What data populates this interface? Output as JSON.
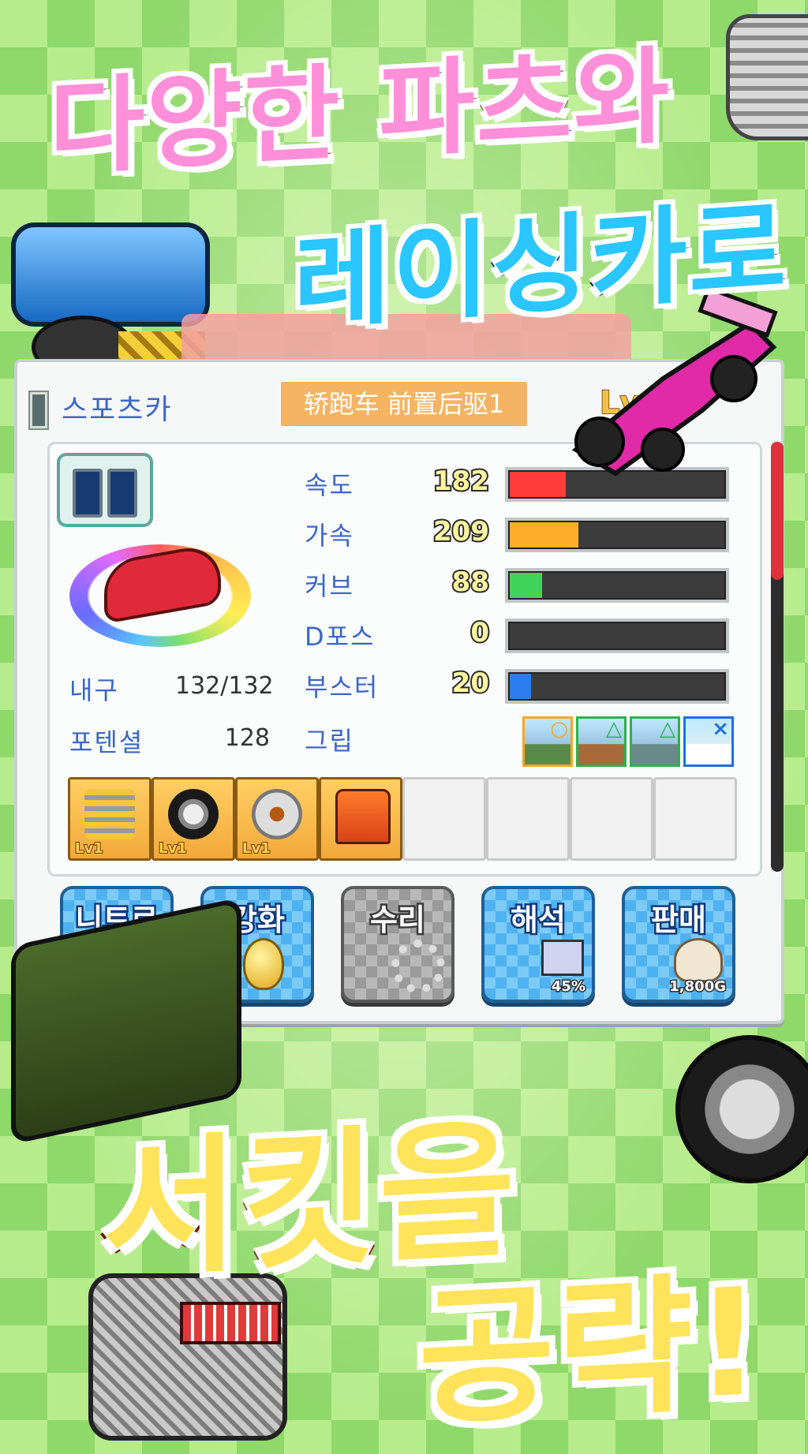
{
  "headlines": {
    "line1": "다양한 파츠와",
    "line2": "레이싱카로",
    "line3": "서킷을",
    "line4": "공략!"
  },
  "panel": {
    "car_name": "스포츠카",
    "type_badge": "轿跑车 前置后驱1",
    "level_badge": "Lv"
  },
  "stats": [
    {
      "label": "속도",
      "value": 182,
      "fill": 0.26,
      "color": "#ff3b3b"
    },
    {
      "label": "가속",
      "value": 209,
      "fill": 0.32,
      "color": "#ffae2b"
    },
    {
      "label": "커브",
      "value": 88,
      "fill": 0.15,
      "color": "#3fd35a"
    },
    {
      "label": "D포스",
      "value": 0,
      "fill": 0.0,
      "color": "#888888"
    },
    {
      "label": "부스터",
      "value": 20,
      "fill": 0.1,
      "color": "#2d7cf0"
    }
  ],
  "left_stats": {
    "durability_label": "내구",
    "durability_value": "132/132",
    "potential_label": "포텐셜",
    "potential_value": "128"
  },
  "grip": {
    "label": "그립",
    "ratings": [
      {
        "symbol": "○",
        "color": "#f5a623",
        "terrain": "road"
      },
      {
        "symbol": "△",
        "color": "#2bb24c",
        "terrain": "dirt"
      },
      {
        "symbol": "△",
        "color": "#2bb24c",
        "terrain": "rocky"
      },
      {
        "symbol": "×",
        "color": "#1e6fe0",
        "terrain": "snow"
      }
    ]
  },
  "parts": [
    {
      "icon": "engine-icon",
      "level": "Lv1"
    },
    {
      "icon": "tire-icon",
      "level": "Lv1"
    },
    {
      "icon": "brake-icon",
      "level": "Lv1"
    },
    {
      "icon": "oil-icon",
      "level": ""
    },
    {
      "icon": "",
      "level": ""
    },
    {
      "icon": "",
      "level": ""
    },
    {
      "icon": "",
      "level": ""
    },
    {
      "icon": "",
      "level": ""
    }
  ],
  "buttons": [
    {
      "label": "니트로",
      "sub": "",
      "enabled": true
    },
    {
      "label": "강화",
      "sub": "",
      "enabled": true
    },
    {
      "label": "수리",
      "sub": "",
      "enabled": false
    },
    {
      "label": "해석",
      "sub": "45%",
      "enabled": true
    },
    {
      "label": "판매",
      "sub": "1,800G",
      "enabled": true
    }
  ]
}
